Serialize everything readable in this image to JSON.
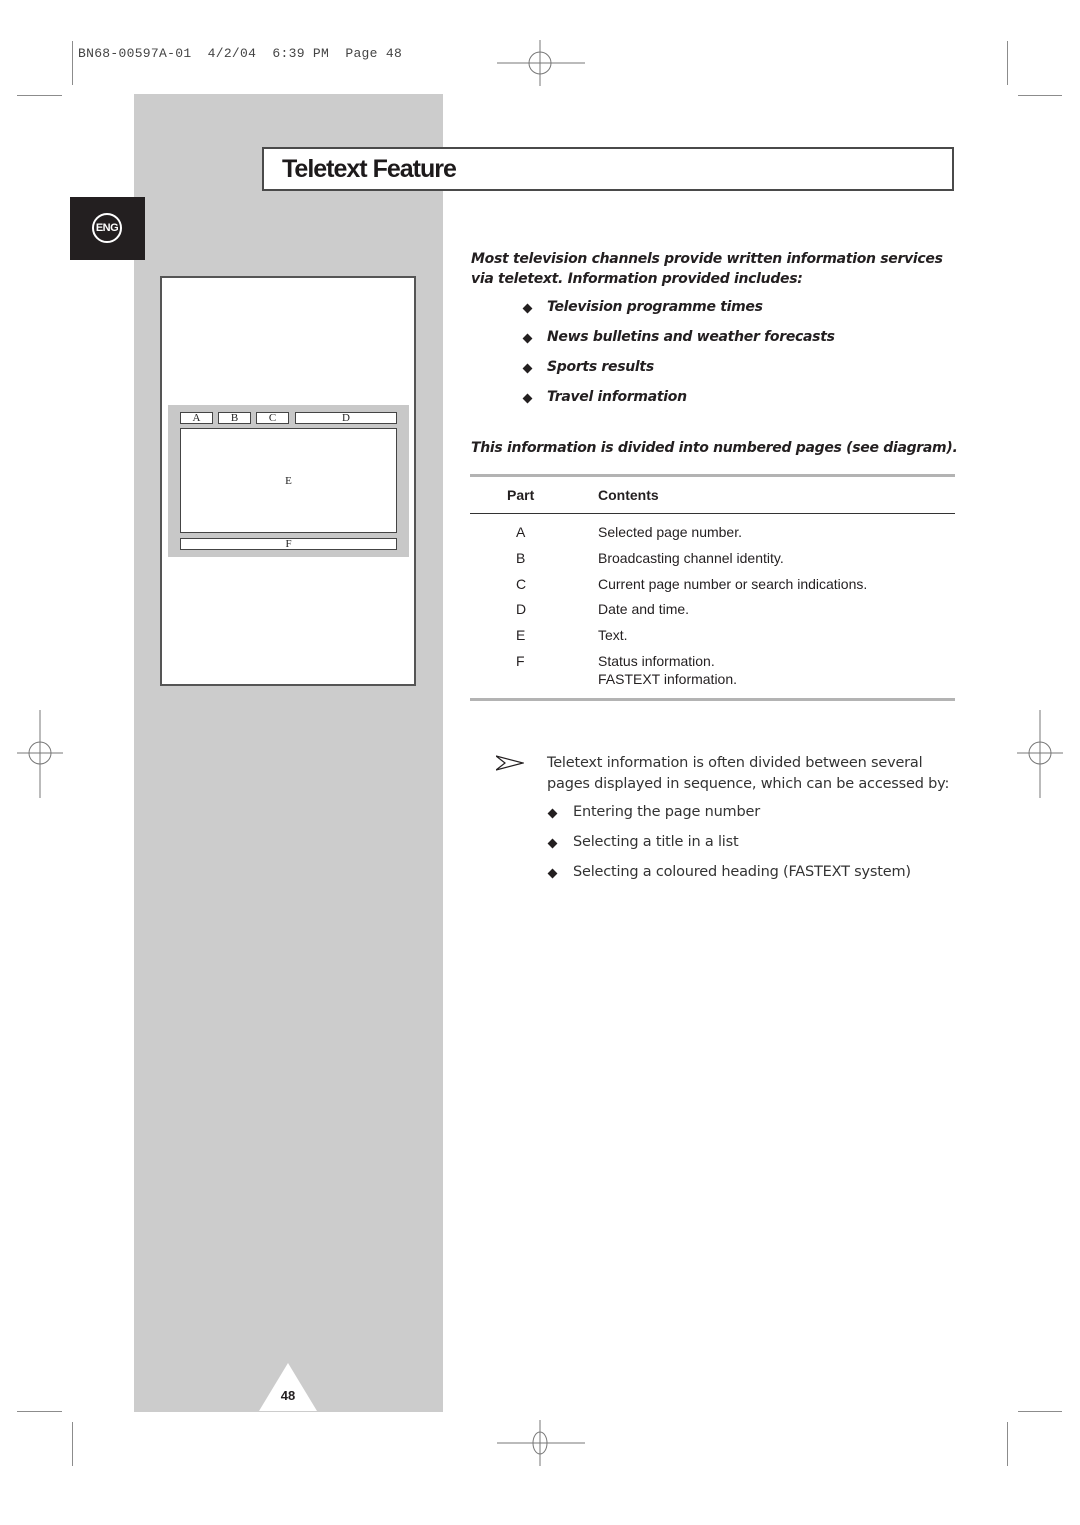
{
  "print_slug": "BN68-00597A-01  4/2/04  6:39 PM  Page 48",
  "page": {
    "title": "Teletext Feature",
    "language_badge": "ENG",
    "page_number": "48"
  },
  "diagram": {
    "header_segments": [
      "A",
      "B",
      "C",
      "D"
    ],
    "body_label": "E",
    "footer_label": "F"
  },
  "intro": {
    "text": "Most television channels provide written information services via teletext. Information provided includes:",
    "bullets": [
      "Television programme times",
      "News bulletins and weather forecasts",
      "Sports results",
      "Travel information"
    ],
    "divided_note": "This information is divided into numbered pages (see diagram)."
  },
  "table": {
    "headers": [
      "Part",
      "Contents"
    ],
    "rows": [
      {
        "part": "A",
        "contents": [
          "Selected page number."
        ]
      },
      {
        "part": "B",
        "contents": [
          "Broadcasting channel identity."
        ]
      },
      {
        "part": "C",
        "contents": [
          "Current page number or search indications."
        ]
      },
      {
        "part": "D",
        "contents": [
          "Date and time."
        ]
      },
      {
        "part": "E",
        "contents": [
          "Text."
        ]
      },
      {
        "part": "F",
        "contents": [
          "Status information.",
          "FASTEXT information."
        ]
      }
    ]
  },
  "note": {
    "icon": "arrow-pointer-icon",
    "text": "Teletext information is often divided between several pages displayed in sequence, which can be accessed by:",
    "bullets": [
      "Entering the page number",
      "Selecting a title in a list",
      "Selecting a coloured heading (FASTEXT system)"
    ]
  }
}
